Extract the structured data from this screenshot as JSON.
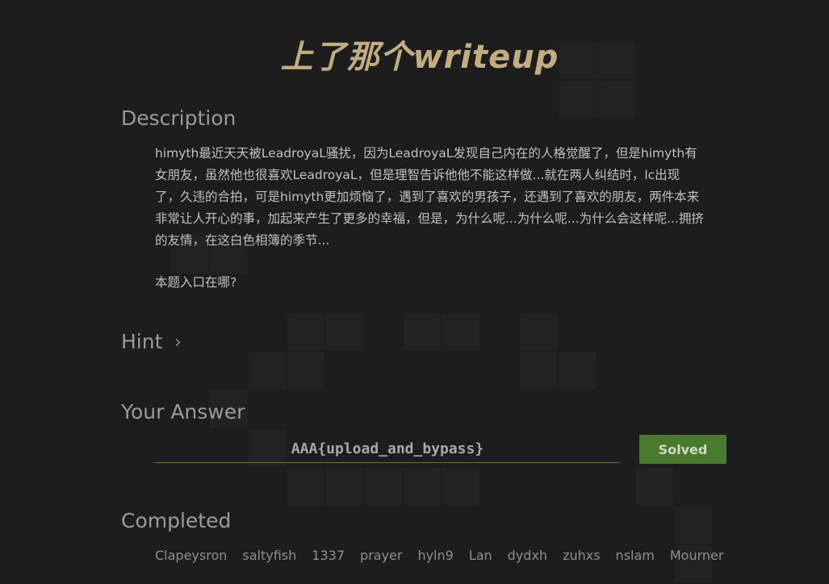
{
  "title": "上了那个writeup",
  "description": {
    "heading": "Description",
    "text": "himyth最近天天被LeadroyaL骚扰，因为LeadroyaL发现自己内在的人格觉醒了，但是himyth有\n女朋友，虽然他也很喜欢LeadroyaL，但是理智告诉他他不能这样做...就在两人纠结时，lc出现\n了，久违的合拍，可是himyth更加烦恼了，遇到了喜欢的男孩子，还遇到了喜欢的朋友，两件本来\n非常让人开心的事，加起来产生了更多的幸福，但是，为什么呢...为什么呢...为什么会这样呢...拥挤\n的友情，在这白色相簿的季节...",
    "entry": "本题入口在哪?"
  },
  "hint": {
    "heading": "Hint",
    "chevron": "›"
  },
  "answer": {
    "heading": "Your Answer",
    "value": "AAA{upload_and_bypass}",
    "button_label": "Solved",
    "button_color": "#4a7a2e"
  },
  "completed": {
    "heading": "Completed",
    "users": [
      "Clapeysron",
      "saltyfish",
      "1337",
      "prayer",
      "hyln9",
      "Lan",
      "dydxh",
      "zuhxs",
      "nslam",
      "Mourner"
    ]
  },
  "colors": {
    "background": "#1d1d1d",
    "title": "#c2ad83",
    "accent": "#4a7a2e"
  }
}
